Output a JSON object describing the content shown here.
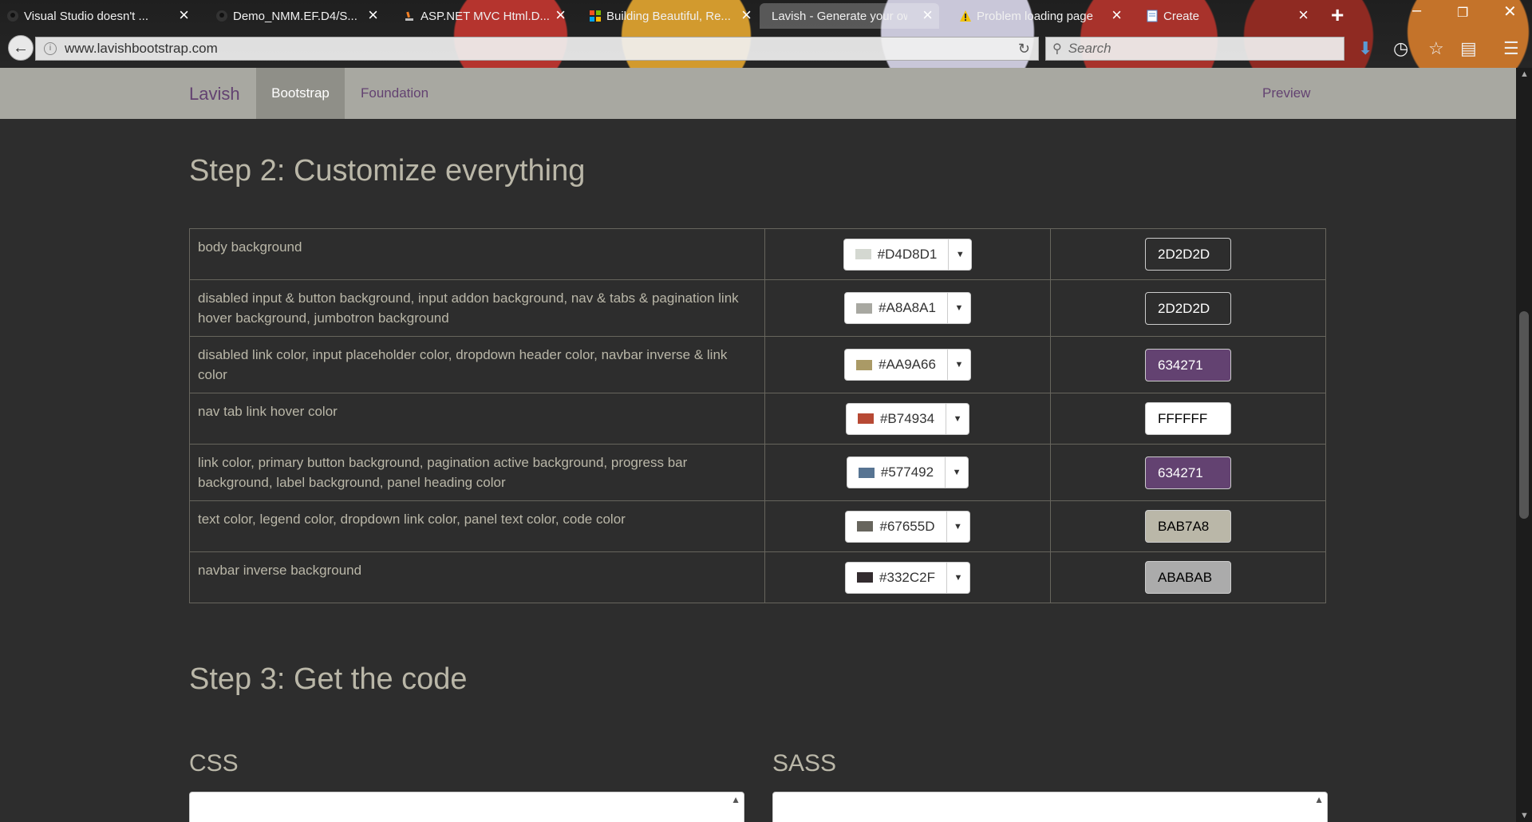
{
  "browser": {
    "tabs": [
      {
        "title": "Visual Studio doesn't ...",
        "icon": "github-icon",
        "active": false
      },
      {
        "title": "Demo_NMM.EF.D4/S...",
        "icon": "github-icon",
        "active": false
      },
      {
        "title": "ASP.NET MVC Html.D...",
        "icon": "stackoverflow-icon",
        "active": false
      },
      {
        "title": "Building Beautiful, Re...",
        "icon": "microsoft-icon",
        "active": false
      },
      {
        "title": "Lavish - Generate your ow...",
        "icon": "",
        "active": true
      },
      {
        "title": "Problem loading page",
        "icon": "warning-icon",
        "active": false
      },
      {
        "title": "Create",
        "icon": "document-icon",
        "active": false
      }
    ],
    "url": "www.lavishbootstrap.com",
    "search_placeholder": "Search"
  },
  "site_nav": {
    "brand": "Lavish",
    "items": [
      "Bootstrap",
      "Foundation"
    ],
    "active": "Bootstrap",
    "preview": "Preview"
  },
  "step2_title": "Step 2: Customize everything",
  "rows": [
    {
      "desc": "body background",
      "hex": "#D4D8D1",
      "swatch": "#D4D8D1",
      "value": "2D2D2D",
      "value_bg": "#2D2D2D",
      "value_fg": "#ffffff"
    },
    {
      "desc": "disabled input & button background, input addon background, nav & tabs & pagination link hover background, jumbotron background",
      "hex": "#A8A8A1",
      "swatch": "#A8A8A1",
      "value": "2D2D2D",
      "value_bg": "#2D2D2D",
      "value_fg": "#ffffff"
    },
    {
      "desc": "disabled link color, input placeholder color, dropdown header color, navbar inverse & link color",
      "hex": "#AA9A66",
      "swatch": "#AA9A66",
      "value": "634271",
      "value_bg": "#634271",
      "value_fg": "#ffffff"
    },
    {
      "desc": "nav tab link hover color",
      "hex": "#B74934",
      "swatch": "#B74934",
      "value": "FFFFFF",
      "value_bg": "#FFFFFF",
      "value_fg": "#000000"
    },
    {
      "desc": "link color, primary button background, pagination active background, progress bar background, label background, panel heading color",
      "hex": "#577492",
      "swatch": "#577492",
      "value": "634271",
      "value_bg": "#634271",
      "value_fg": "#ffffff"
    },
    {
      "desc": "text color, legend color, dropdown link color, panel text color, code color",
      "hex": "#67655D",
      "swatch": "#67655D",
      "value": "BAB7A8",
      "value_bg": "#BAB7A8",
      "value_fg": "#000000"
    },
    {
      "desc": "navbar inverse background",
      "hex": "#332C2F",
      "swatch": "#332C2F",
      "value": "ABABAB",
      "value_bg": "#ABABAB",
      "value_fg": "#000000"
    }
  ],
  "step3_title": "Step 3: Get the code",
  "code_labels": {
    "css": "CSS",
    "sass": "SASS"
  },
  "colors": {
    "page_bg": "#2D2D2D",
    "text": "#BAB7A8",
    "brand": "#634271",
    "navbar": "#A8A8A1"
  }
}
